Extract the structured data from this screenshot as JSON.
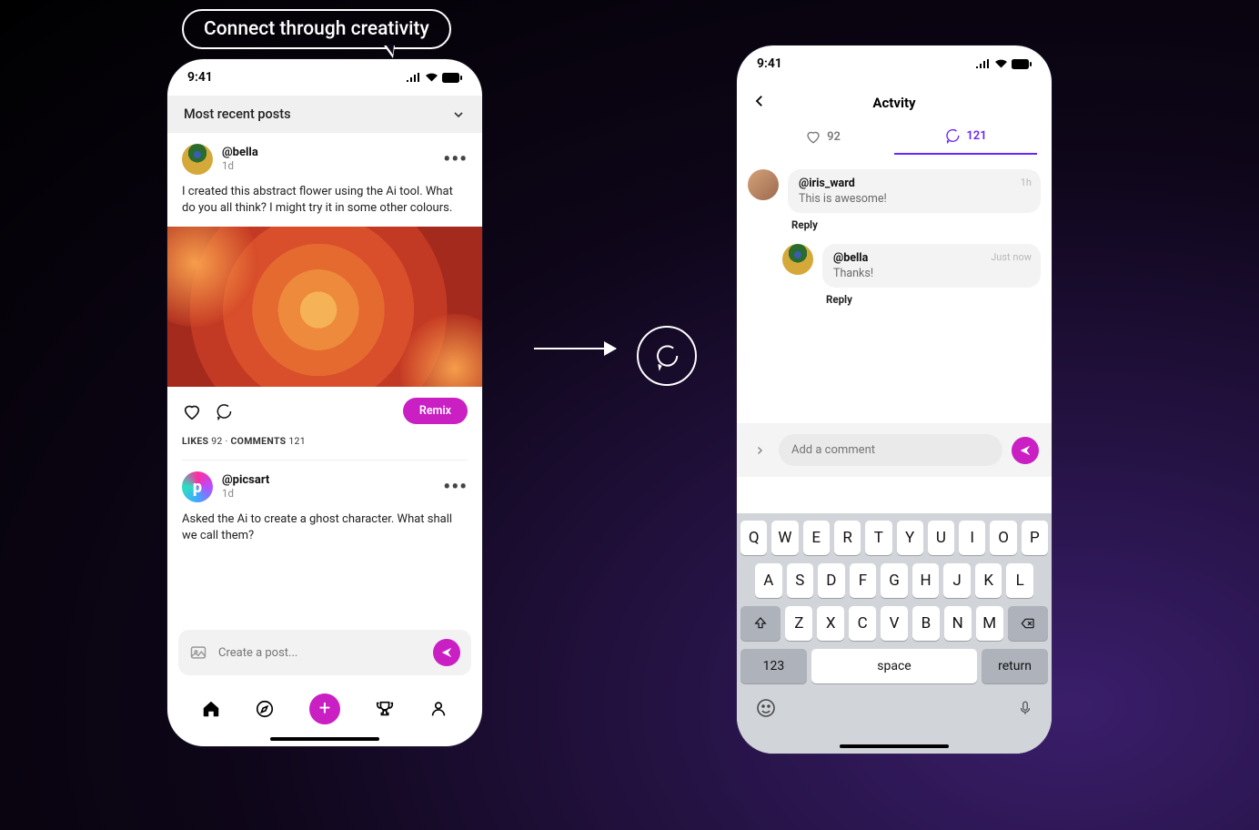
{
  "bubble_text": "Connect through creativity",
  "status_time": "9:41",
  "left": {
    "header": "Most recent posts",
    "posts": [
      {
        "user": "@bella",
        "time": "1d",
        "body": "I created this abstract flower using the Ai tool. What do you all think? I might try it in some other colours."
      },
      {
        "user": "@picsart",
        "time": "1d",
        "body": "Asked the Ai to create a ghost character. What shall we call them?"
      }
    ],
    "remix_label": "Remix",
    "likes_label": "LIKES",
    "likes_count": "92",
    "comments_label": "COMMENTS",
    "comments_count": "121",
    "create_placeholder": "Create a post..."
  },
  "right": {
    "title": "Actvity",
    "tabs": {
      "likes": "92",
      "comments": "121"
    },
    "comments": [
      {
        "user": "@iris_ward",
        "text": "This is awesome!",
        "time": "1h"
      },
      {
        "user": "@bella",
        "text": "Thanks!",
        "time": "Just now"
      }
    ],
    "reply_label": "Reply",
    "input_placeholder": "Add a comment"
  },
  "keyboard": {
    "row1": [
      "Q",
      "W",
      "E",
      "R",
      "T",
      "Y",
      "U",
      "I",
      "O",
      "P"
    ],
    "row2": [
      "A",
      "S",
      "D",
      "F",
      "G",
      "H",
      "J",
      "K",
      "L"
    ],
    "row3": [
      "Z",
      "X",
      "C",
      "V",
      "B",
      "N",
      "M"
    ],
    "num": "123",
    "space": "space",
    "ret": "return"
  }
}
